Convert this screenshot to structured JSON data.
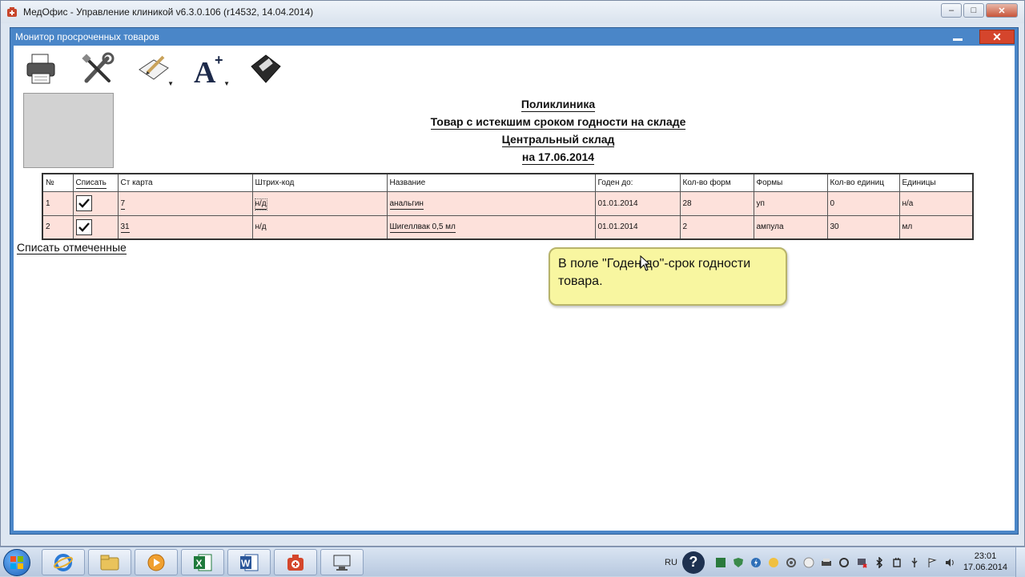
{
  "app": {
    "title": "МедОфис - Управление клиникой v6.3.0.106 (r14532, 14.04.2014)",
    "minimize": "‒",
    "maximize": "□",
    "close": "✕"
  },
  "child": {
    "title": "Монитор просроченных товаров",
    "close": "✕"
  },
  "toolbar": {
    "icons": [
      "printer-icon",
      "tools-icon",
      "edit-icon",
      "font-icon",
      "save-icon"
    ]
  },
  "report": {
    "line1": "Поликлиника",
    "line2": "Товар с истекшим сроком годности на складе",
    "line3": "Центральный склад",
    "line4": "на 17.06.2014"
  },
  "table": {
    "headers": [
      "№",
      "Списать",
      "Ст карта",
      "Штрих-код",
      "Название",
      "Годен до:",
      "Кол-во форм",
      "Формы",
      "Кол-во единиц",
      "Единицы"
    ],
    "rows": [
      {
        "num": "1",
        "checked": true,
        "card": "7",
        "barcode": "н/д",
        "name": "анальгин",
        "expires": "01.01.2014",
        "forms_qty": "28",
        "forms": "уп",
        "units_qty": "0",
        "units": "н/а"
      },
      {
        "num": "2",
        "checked": true,
        "card": "31",
        "barcode": "н/д",
        "name": "Шигеллвак 0,5 мл",
        "expires": "01.01.2014",
        "forms_qty": "2",
        "forms": "ампула",
        "units_qty": "30",
        "units": "мл"
      }
    ]
  },
  "write_off_link": "Списать отмеченные",
  "balloon": "В поле \"Годен до\"-срок годности товара.",
  "taskbar": {
    "apps": [
      "internet-explorer-icon",
      "file-explorer-icon",
      "media-player-icon",
      "excel-icon",
      "word-icon",
      "medoffice-icon",
      "remote-desktop-icon"
    ],
    "language": "RU",
    "help": "?",
    "time": "23:01",
    "date": "17.06.2014"
  }
}
